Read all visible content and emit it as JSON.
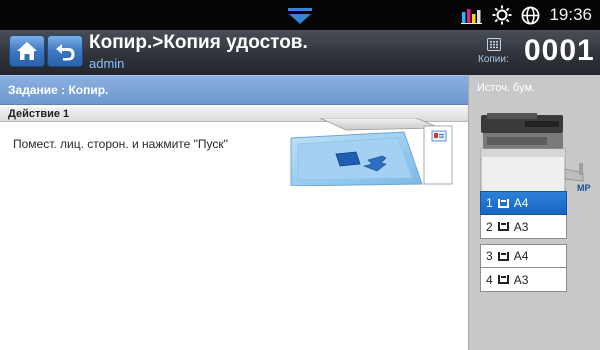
{
  "status_bar": {
    "time": "19:36",
    "icons": [
      "pull-down-handle-icon",
      "toner-levels-icon",
      "brightness-icon",
      "globe-icon"
    ]
  },
  "title_bar": {
    "title": "Копир.>Копия удостов.",
    "subtitle": "admin",
    "copies_label": "Копии:",
    "copies_value": "0001"
  },
  "job": {
    "header": "Задание : Копир.",
    "step_title": "Действие 1",
    "instruction": "Помест. лиц. сторон. и нажмите \"Пуск\""
  },
  "paper_source": {
    "label": "Источ. бум.",
    "mp_label": "MP",
    "trays": [
      {
        "num": "1",
        "size": "A4",
        "selected": true
      },
      {
        "num": "2",
        "size": "A3",
        "selected": false
      },
      {
        "num": "3",
        "size": "A4",
        "selected": false
      },
      {
        "num": "4",
        "size": "A3",
        "selected": false
      }
    ]
  },
  "colors": {
    "accent": "#1767c2",
    "title_bar": "#31343b",
    "job_header": "#6e98cf",
    "panel": "#c8c8c8"
  }
}
